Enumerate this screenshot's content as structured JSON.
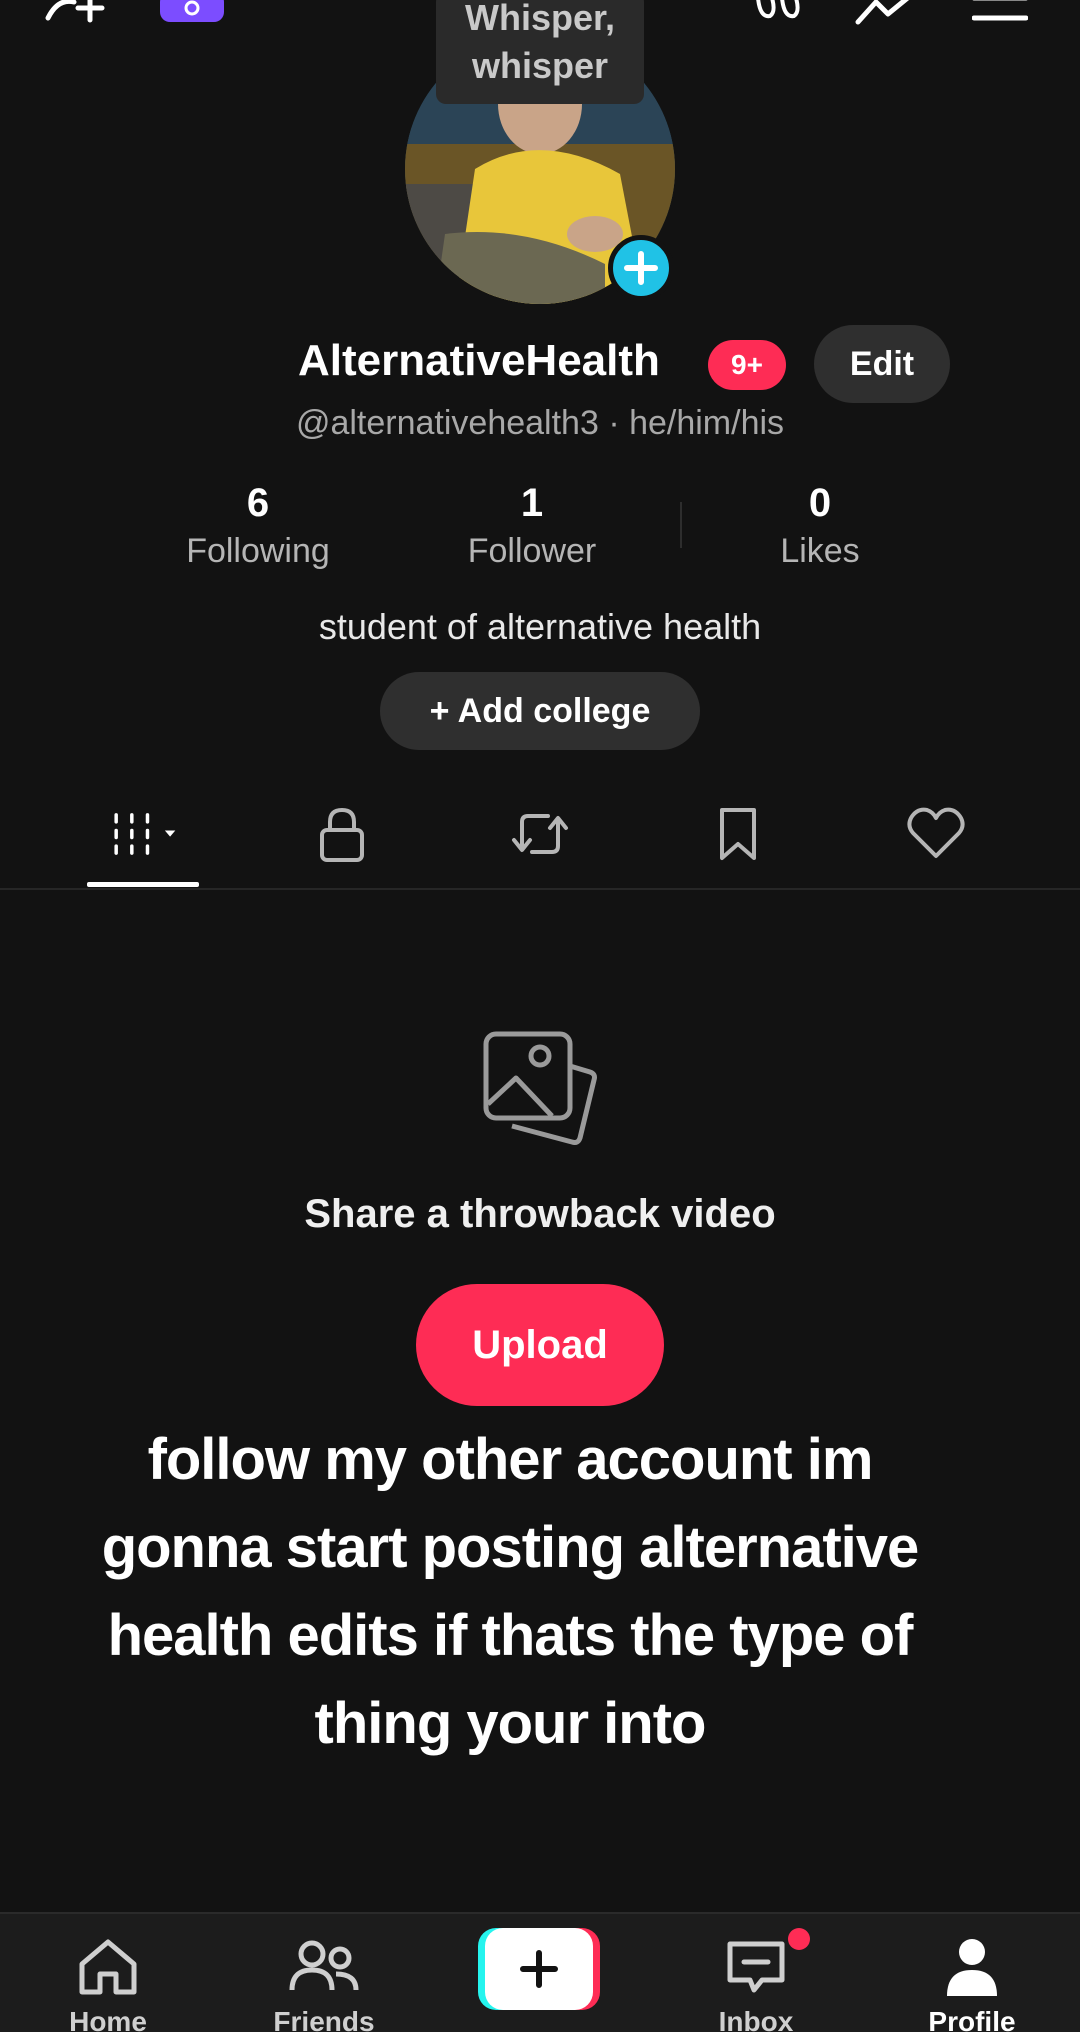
{
  "colors": {
    "background": "#121212",
    "accent_red": "#fe2c55",
    "accent_cyan": "#20c2e6",
    "button_gray": "#2f2f2f",
    "streak_purple": "#7c4dff"
  },
  "header": {
    "add_friend_icon": "add-person-icon",
    "streak_icon": "streak-badge-icon",
    "tooltip_line1": "Whisper,",
    "tooltip_line2": "whisper",
    "footprint_icon": "footprints-icon",
    "analytics_icon": "analytics-icon",
    "menu_icon": "menu-icon"
  },
  "profile": {
    "display_name": "AlternativeHealth",
    "notification_badge": "9+",
    "edit_label": "Edit",
    "handle_line": "@alternativehealth3 · he/him/his",
    "bio": "student of alternative health",
    "add_college_label": "+ Add college"
  },
  "stats": [
    {
      "value": "6",
      "label": "Following"
    },
    {
      "value": "1",
      "label": "Follower"
    },
    {
      "value": "0",
      "label": "Likes"
    }
  ],
  "tabs": [
    {
      "name": "videos",
      "icon": "grid-dropdown-icon",
      "active": true
    },
    {
      "name": "private",
      "icon": "lock-icon"
    },
    {
      "name": "reposts",
      "icon": "repost-icon"
    },
    {
      "name": "favorites",
      "icon": "bookmark-icon"
    },
    {
      "name": "liked",
      "icon": "heart-icon"
    }
  ],
  "empty_state": {
    "icon": "photos-icon",
    "title": "Share a throwback video",
    "upload_label": "Upload"
  },
  "overlay_caption": "follow my other account im gonna start posting alternative health edits if thats the type of thing your into",
  "navbar": {
    "home": "Home",
    "friends": "Friends",
    "inbox": "Inbox",
    "profile": "Profile"
  }
}
